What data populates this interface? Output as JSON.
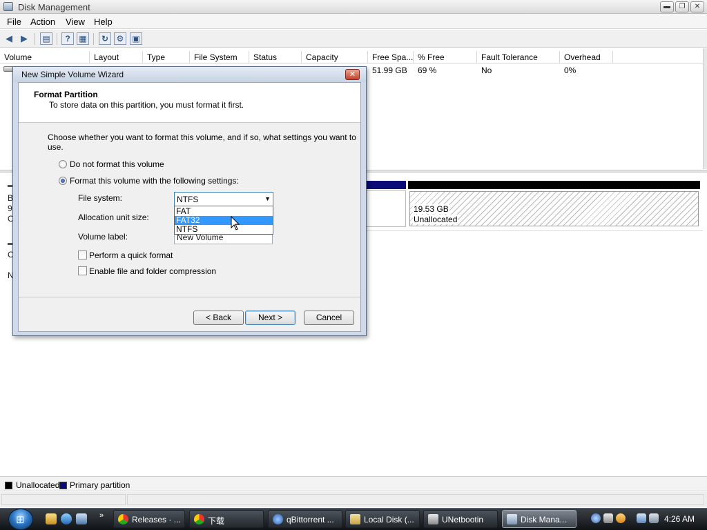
{
  "window": {
    "title": "Disk Management",
    "buttons": {
      "minimize": "▬",
      "restore": "❐",
      "close": "✕"
    }
  },
  "menu": [
    "File",
    "Action",
    "View",
    "Help"
  ],
  "toolbar": {
    "icons": [
      "back-arrow-icon",
      "forward-arrow-icon",
      "up-level-icon",
      "help-icon",
      "properties-icon",
      "refresh-icon",
      "settings-icon",
      "export-icon"
    ],
    "help_glyph": "?"
  },
  "volume_list": {
    "columns": [
      "Volume",
      "Layout",
      "Type",
      "File System",
      "Status",
      "Capacity",
      "Free Spa...",
      "% Free",
      "Fault Tolerance",
      "Overhead"
    ],
    "row": {
      "free_space": "51.99 GB",
      "percent_free": "69 %",
      "fault_tolerance": "No",
      "overhead": "0%"
    }
  },
  "disk_area": {
    "left_stubs": [
      "B",
      "9.",
      "O",
      "C",
      "N"
    ],
    "unallocated_size": "19.53 GB",
    "unallocated_label": "Unallocated",
    "colors": {
      "primary_partition": "#0a0a78",
      "unallocated": "#000000"
    }
  },
  "legend": {
    "unallocated": "Unallocated",
    "primary": "Primary partition"
  },
  "wizard": {
    "title": "New Simple Volume Wizard",
    "close_glyph": "✕",
    "heading": "Format Partition",
    "subheading": "To store data on this partition, you must format it first.",
    "description": "Choose whether you want to format this volume, and if so, what settings you want to use.",
    "radio_no_format": "Do not format this volume",
    "radio_format": "Format this volume with the following settings:",
    "selected_radio": "format",
    "file_system_label": "File system:",
    "file_system_value": "NTFS",
    "file_system_options": [
      "FAT",
      "FAT32",
      "NTFS"
    ],
    "highlighted_option": "FAT32",
    "allocation_label": "Allocation unit size:",
    "volume_label_label": "Volume label:",
    "volume_label_value": "New Volume",
    "quick_format_label": "Perform a quick format",
    "quick_format_checked": false,
    "compression_label": "Enable file and folder compression",
    "compression_checked": false,
    "back_button": "< Back",
    "next_button": "Next >",
    "cancel_button": "Cancel"
  },
  "taskbar": {
    "start_glyph": "⊞",
    "tasks": [
      {
        "label": "Releases · ...",
        "icon": "chrome-icon",
        "active": false
      },
      {
        "label": "下载",
        "icon": "chrome-icon",
        "active": false
      },
      {
        "label": "qBittorrent ...",
        "icon": "qbittorrent-icon",
        "active": false
      },
      {
        "label": "Local Disk (...",
        "icon": "folder-icon",
        "active": false
      },
      {
        "label": "UNetbootin",
        "icon": "unetbootin-icon",
        "active": false
      },
      {
        "label": "Disk Mana...",
        "icon": "disk-management-icon",
        "active": true
      }
    ],
    "clock": "4:26 AM"
  }
}
